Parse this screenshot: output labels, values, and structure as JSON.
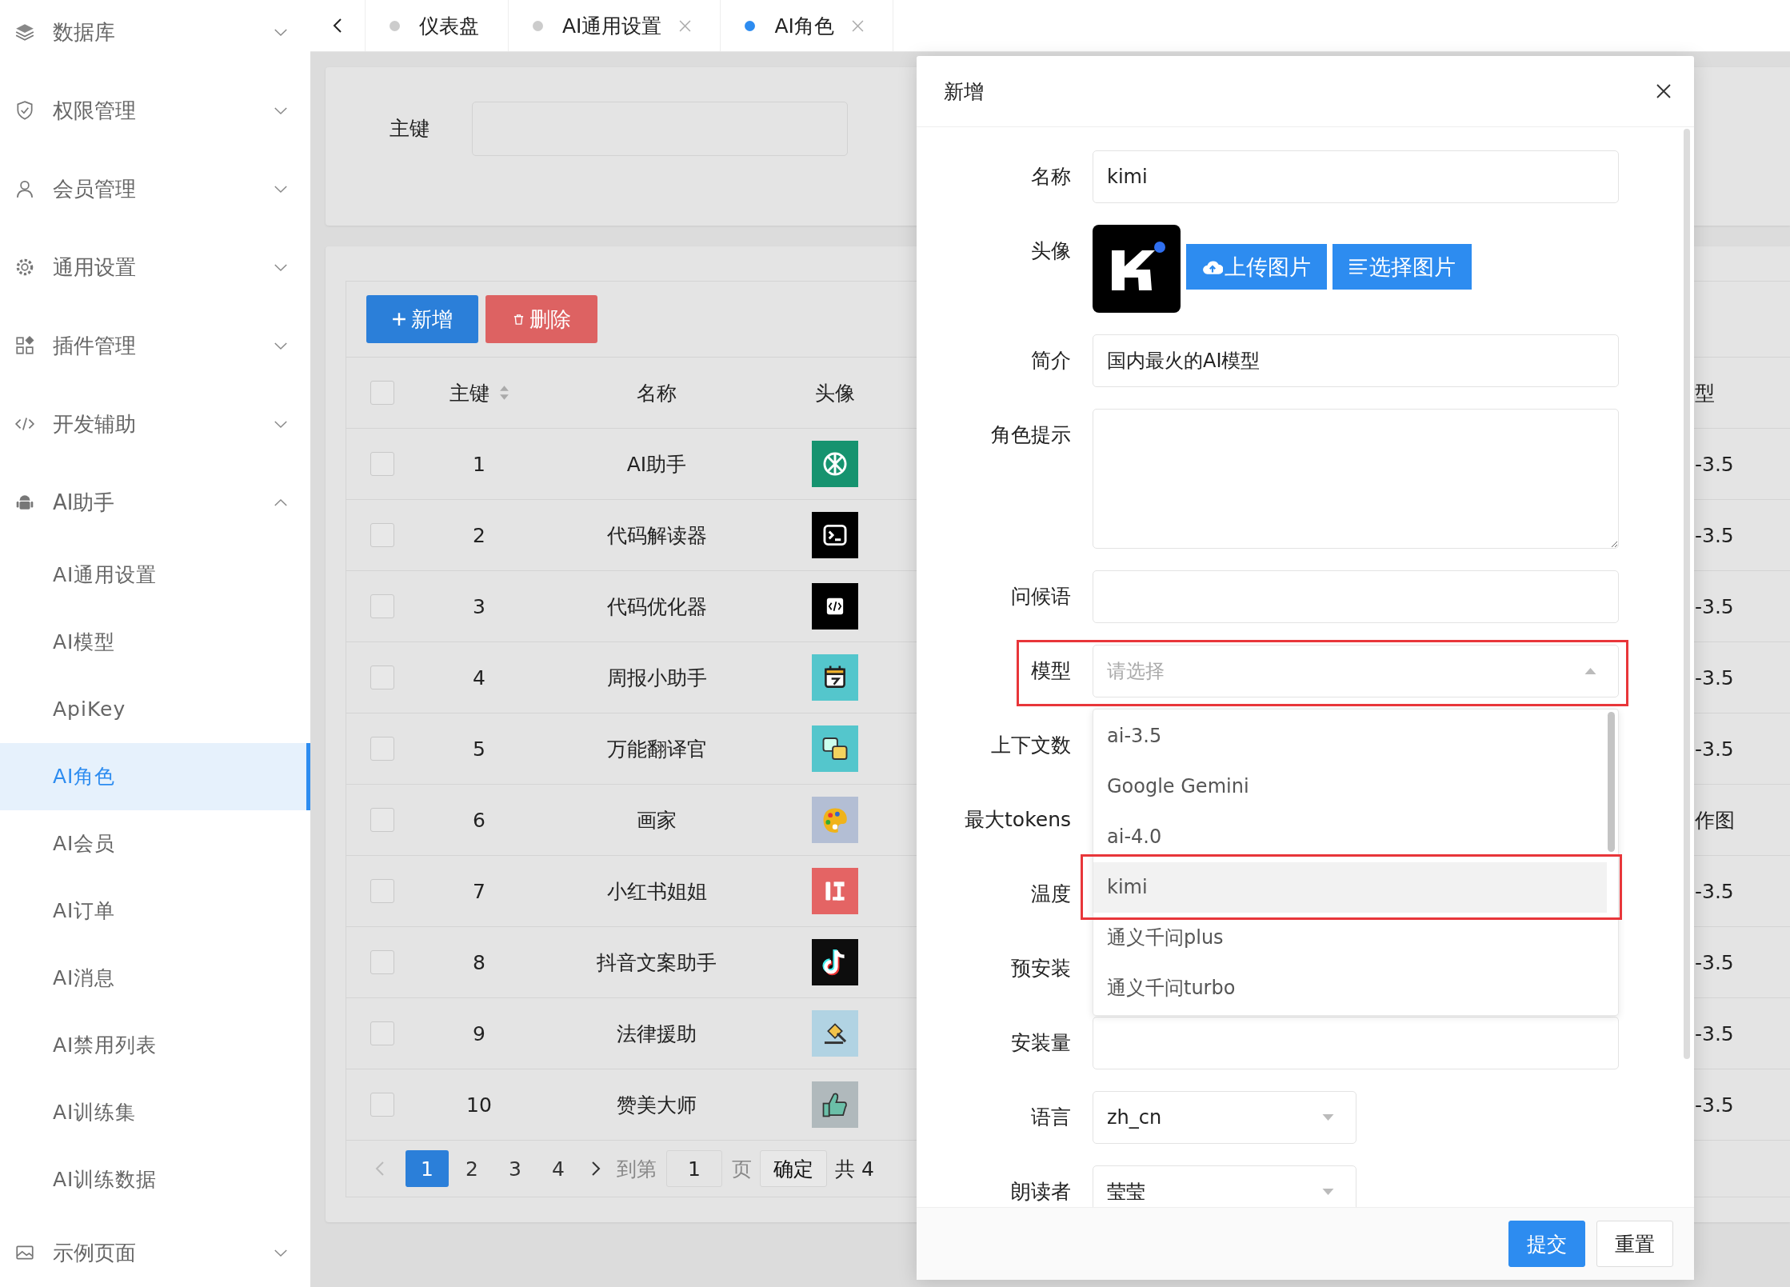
{
  "sidebar": {
    "items": [
      {
        "label": "数据库",
        "expanded": false
      },
      {
        "label": "权限管理",
        "expanded": false
      },
      {
        "label": "会员管理",
        "expanded": false
      },
      {
        "label": "通用设置",
        "expanded": false
      },
      {
        "label": "插件管理",
        "expanded": false
      },
      {
        "label": "开发辅助",
        "expanded": false
      },
      {
        "label": "AI助手",
        "expanded": true,
        "children": [
          {
            "label": "AI通用设置",
            "selected": false
          },
          {
            "label": "AI模型",
            "selected": false
          },
          {
            "label": "ApiKey",
            "selected": false
          },
          {
            "label": "AI角色",
            "selected": true
          },
          {
            "label": "AI会员",
            "selected": false
          },
          {
            "label": "AI订单",
            "selected": false
          },
          {
            "label": "AI消息",
            "selected": false
          },
          {
            "label": "AI禁用列表",
            "selected": false
          },
          {
            "label": "AI训练集",
            "selected": false
          },
          {
            "label": "AI训练数据",
            "selected": false
          }
        ]
      },
      {
        "label": "示例页面",
        "expanded": false
      }
    ]
  },
  "tabs": [
    {
      "label": "仪表盘",
      "selected": false,
      "closable": false
    },
    {
      "label": "AI通用设置",
      "selected": false,
      "closable": true
    },
    {
      "label": "AI角色",
      "selected": true,
      "closable": true
    }
  ],
  "search": {
    "label": "主键"
  },
  "toolbar": {
    "buttons": [
      {
        "label": "新增",
        "kind": "add"
      },
      {
        "label": "删除",
        "kind": "delete"
      }
    ]
  },
  "table": {
    "all_checked": false,
    "columns": [
      {
        "label": "主键",
        "sortable": true
      },
      {
        "label": "名称",
        "sortable": false
      },
      {
        "label": "头像"
      },
      {
        "label": "型"
      }
    ],
    "rows": [
      {
        "checked": false,
        "id": "1",
        "name": "AI助手",
        "color": "#16936f",
        "column_4": "-3.5"
      },
      {
        "checked": false,
        "id": "2",
        "name": "代码解读器",
        "color": "#000000",
        "column_4": "-3.5"
      },
      {
        "checked": false,
        "id": "3",
        "name": "代码优化器",
        "color": "#000000",
        "column_4": "-3.5"
      },
      {
        "checked": false,
        "id": "4",
        "name": "周报小助手",
        "color": "#54c6cc",
        "column_4": "-3.5"
      },
      {
        "checked": false,
        "id": "5",
        "name": "万能翻译官",
        "color": "#54c6cc",
        "column_4": "-3.5"
      },
      {
        "checked": false,
        "id": "6",
        "name": "画家",
        "color": "#b3bed4",
        "column_4": "作图"
      },
      {
        "checked": false,
        "id": "7",
        "name": "小红书姐姐",
        "color": "#e46464",
        "column_4": "-3.5"
      },
      {
        "checked": false,
        "id": "8",
        "name": "抖音文案助手",
        "color": "#0d0d0d",
        "column_4": "-3.5"
      },
      {
        "checked": false,
        "id": "9",
        "name": "法律援助",
        "color": "#b1d3e3",
        "column_4": "-3.5"
      },
      {
        "checked": false,
        "id": "10",
        "name": "赞美大师",
        "color": "#b0b9bc",
        "column_4": "-3.5"
      }
    ]
  },
  "pagination": {
    "pages": [
      {
        "label": "1",
        "selected": true
      },
      {
        "label": "2",
        "selected": false
      },
      {
        "label": "3",
        "selected": false
      },
      {
        "label": "4",
        "selected": false
      }
    ],
    "prev_disabled": true,
    "goto_label": "到第",
    "goto_value": "1",
    "page_label": "页",
    "confirm": "确定",
    "total": "共 4"
  },
  "dialog": {
    "title": "新增",
    "fields": [
      {
        "label": "名称",
        "kind": "input",
        "value": "kimi",
        "highlighted": false
      },
      {
        "label": "头像",
        "kind": "avatar",
        "buttons": [
          {
            "label": "上传图片",
            "kind": "upload"
          },
          {
            "label": "选择图片",
            "kind": "choose"
          }
        ],
        "highlighted": false
      },
      {
        "label": "简介",
        "kind": "input",
        "value": "国内最火的AI模型",
        "highlighted": false
      },
      {
        "label": "角色提示",
        "kind": "textarea",
        "highlighted": false
      },
      {
        "label": "问候语",
        "kind": "input",
        "highlighted": false
      },
      {
        "label": "模型",
        "kind": "select",
        "placeholder": "请选择",
        "expanded": true,
        "highlighted": true,
        "options": [
          {
            "label": "ai-3.5",
            "hovered": false,
            "highlighted": false
          },
          {
            "label": "Google Gemini",
            "hovered": false,
            "highlighted": false
          },
          {
            "label": "ai-4.0",
            "hovered": false,
            "highlighted": false
          },
          {
            "label": "kimi",
            "hovered": true,
            "highlighted": true
          },
          {
            "label": "通义千问plus",
            "hovered": false,
            "highlighted": false
          },
          {
            "label": "通义千问turbo",
            "hovered": false,
            "highlighted": false
          }
        ]
      },
      {
        "label": "上下文数",
        "kind": "covered",
        "highlighted": false
      },
      {
        "label": "最大tokens",
        "kind": "covered",
        "highlighted": false
      },
      {
        "label": "温度",
        "kind": "covered",
        "highlighted": false
      },
      {
        "label": "预安装",
        "kind": "covered",
        "highlighted": false
      },
      {
        "label": "安装量",
        "kind": "input",
        "highlighted": false
      },
      {
        "label": "语言",
        "kind": "select",
        "value": "zh_cn",
        "expanded": false,
        "highlighted": false
      },
      {
        "label": "朗读者",
        "kind": "select",
        "value": "莹莹",
        "expanded": false,
        "highlighted": false
      }
    ],
    "buttons": [
      {
        "label": "提交",
        "kind": "primary"
      },
      {
        "label": "重置",
        "kind": "default"
      }
    ]
  }
}
